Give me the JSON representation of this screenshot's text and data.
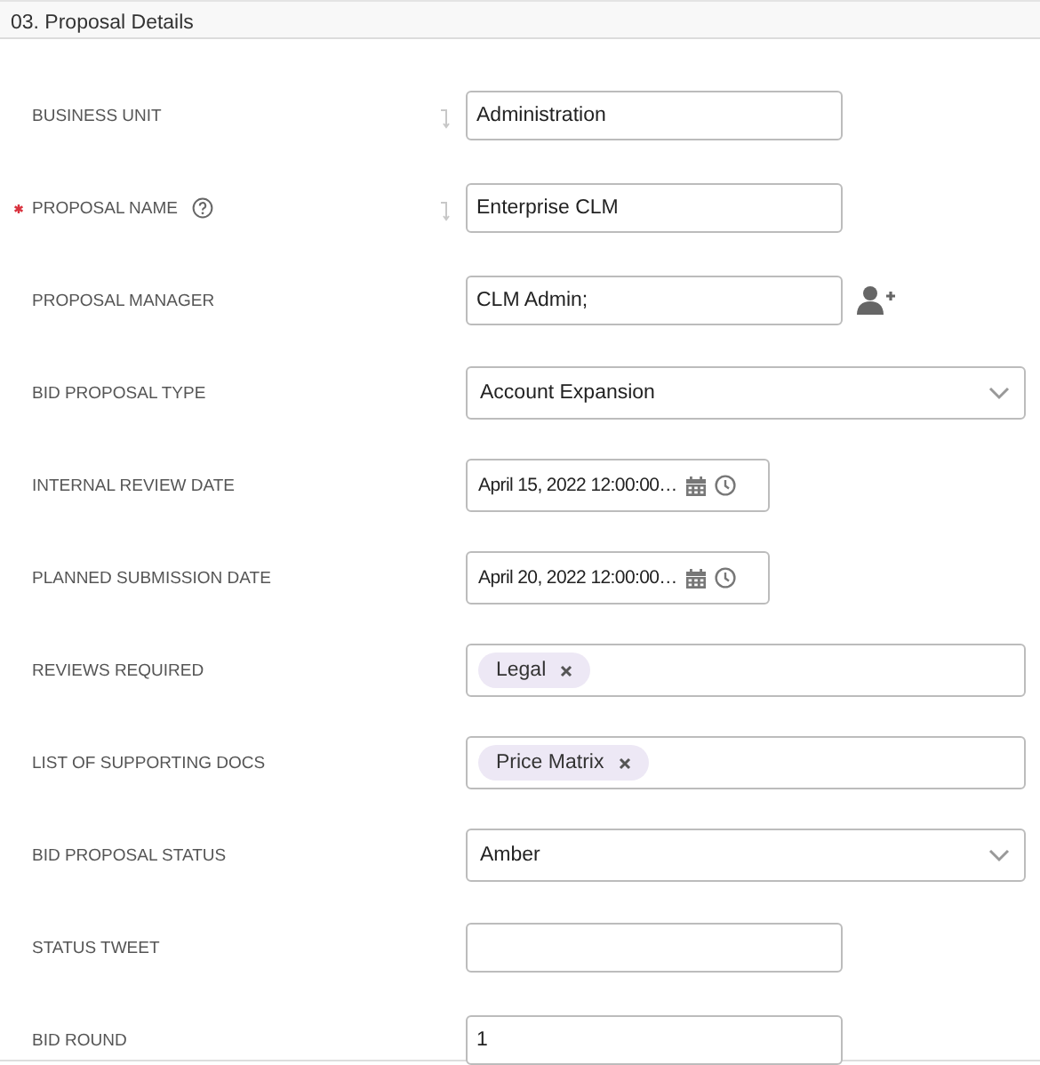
{
  "section": {
    "title": "03. Proposal Details"
  },
  "fields": [
    {
      "label": "BUSINESS UNIT",
      "kind": "text",
      "value": "Administration",
      "required": false,
      "help": false,
      "linked": true
    },
    {
      "label": "PROPOSAL NAME",
      "kind": "text",
      "value": "Enterprise CLM",
      "required": true,
      "help": true,
      "linked": true
    },
    {
      "label": "PROPOSAL MANAGER",
      "kind": "people",
      "value": "CLM Admin;",
      "required": false,
      "help": false,
      "linked": false
    },
    {
      "label": "BID PROPOSAL TYPE",
      "kind": "select",
      "value": "Account Expansion",
      "required": false,
      "help": false,
      "linked": false
    },
    {
      "label": "INTERNAL REVIEW DATE",
      "kind": "datetime",
      "value": "April 15, 2022 12:00:00…",
      "required": false,
      "help": false,
      "linked": false
    },
    {
      "label": "PLANNED SUBMISSION DATE",
      "kind": "datetime",
      "value": "April 20, 2022 12:00:00…",
      "required": false,
      "help": false,
      "linked": false
    },
    {
      "label": "REVIEWS REQUIRED",
      "kind": "tags",
      "tags": [
        "Legal"
      ],
      "required": false,
      "help": false,
      "linked": false
    },
    {
      "label": "LIST OF SUPPORTING DOCS",
      "kind": "tags",
      "tags": [
        "Price Matrix"
      ],
      "required": false,
      "help": false,
      "linked": false
    },
    {
      "label": "BID PROPOSAL STATUS",
      "kind": "select",
      "value": "Amber",
      "required": false,
      "help": false,
      "linked": false
    },
    {
      "label": "STATUS TWEET",
      "kind": "text",
      "required": false,
      "help": false,
      "linked": false
    },
    {
      "label": "BID ROUND",
      "kind": "text",
      "value": "1",
      "required": false,
      "help": false,
      "linked": false
    }
  ]
}
